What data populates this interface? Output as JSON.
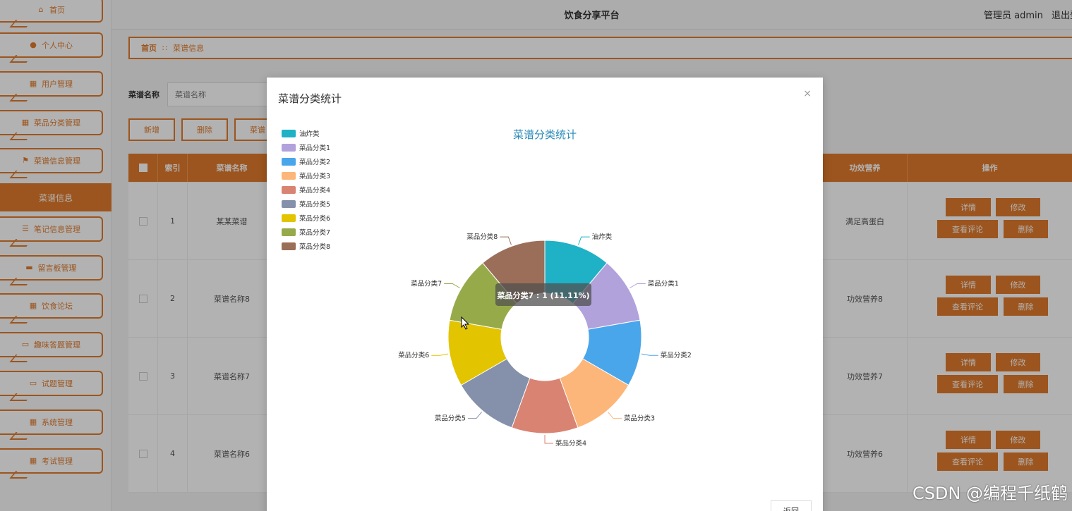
{
  "header": {
    "title": "饮食分享平台",
    "user": "管理员 admin",
    "logout": "退出登"
  },
  "sidebar": {
    "items": [
      {
        "label": "首页",
        "icon": "home-icon"
      },
      {
        "label": "个人中心",
        "icon": "user-icon"
      },
      {
        "label": "用户管理",
        "icon": "grid-icon"
      },
      {
        "label": "菜品分类管理",
        "icon": "grid-icon"
      },
      {
        "label": "菜谱信息管理",
        "icon": "flag-icon"
      },
      {
        "label": "笔记信息管理",
        "icon": "sliders-icon"
      },
      {
        "label": "留言板管理",
        "icon": "chat-icon"
      },
      {
        "label": "饮食论坛",
        "icon": "grid-icon"
      },
      {
        "label": "趣味答题管理",
        "icon": "monitor-icon"
      },
      {
        "label": "试题管理",
        "icon": "monitor-icon"
      },
      {
        "label": "系统管理",
        "icon": "grid-icon"
      },
      {
        "label": "考试管理",
        "icon": "grid-icon"
      }
    ],
    "active_sub": "菜谱信息"
  },
  "breadcrumb": {
    "home": "首页",
    "sep": "∷",
    "current": "菜谱信息"
  },
  "search": {
    "label": "菜谱名称",
    "placeholder": "菜谱名称"
  },
  "buttons": {
    "add": "新增",
    "delete": "删除",
    "stats": "菜谱"
  },
  "table": {
    "headers": {
      "index": "索引",
      "name": "菜谱名称",
      "nutrition": "功效营养",
      "ops": "操作"
    },
    "rows": [
      {
        "index": "1",
        "name": "某某菜谱",
        "nutrition": "满足高蛋白"
      },
      {
        "index": "2",
        "name": "菜谱名称8",
        "nutrition": "功效营养8"
      },
      {
        "index": "3",
        "name": "菜谱名称7",
        "nutrition": "功效营养7"
      },
      {
        "index": "4",
        "name": "菜谱名称6",
        "nutrition": "功效营养6"
      }
    ],
    "op_labels": {
      "detail": "详情",
      "edit": "修改",
      "comment": "查看评论",
      "delete": "删除"
    }
  },
  "modal": {
    "title": "菜谱分类统计",
    "close": "×",
    "return": "返回"
  },
  "tooltip": "菜品分类7 : 1 (11.11%)",
  "watermark": "CSDN @编程千纸鹤",
  "colors": {
    "accent": "#e07a2c"
  },
  "chart_data": {
    "type": "pie",
    "title": "菜谱分类统计",
    "donut": true,
    "legend_position": "top-left",
    "categories": [
      "油炸类",
      "菜品分类1",
      "菜品分类2",
      "菜品分类3",
      "菜品分类4",
      "菜品分类5",
      "菜品分类6",
      "菜品分类7",
      "菜品分类8"
    ],
    "values": [
      1,
      1,
      1,
      1,
      1,
      1,
      1,
      1,
      1
    ],
    "colors": [
      "#1fb1c6",
      "#b1a2dc",
      "#4aa6ea",
      "#fdb679",
      "#d98373",
      "#8591ab",
      "#e3c400",
      "#97aa4a",
      "#9a6e58"
    ]
  }
}
